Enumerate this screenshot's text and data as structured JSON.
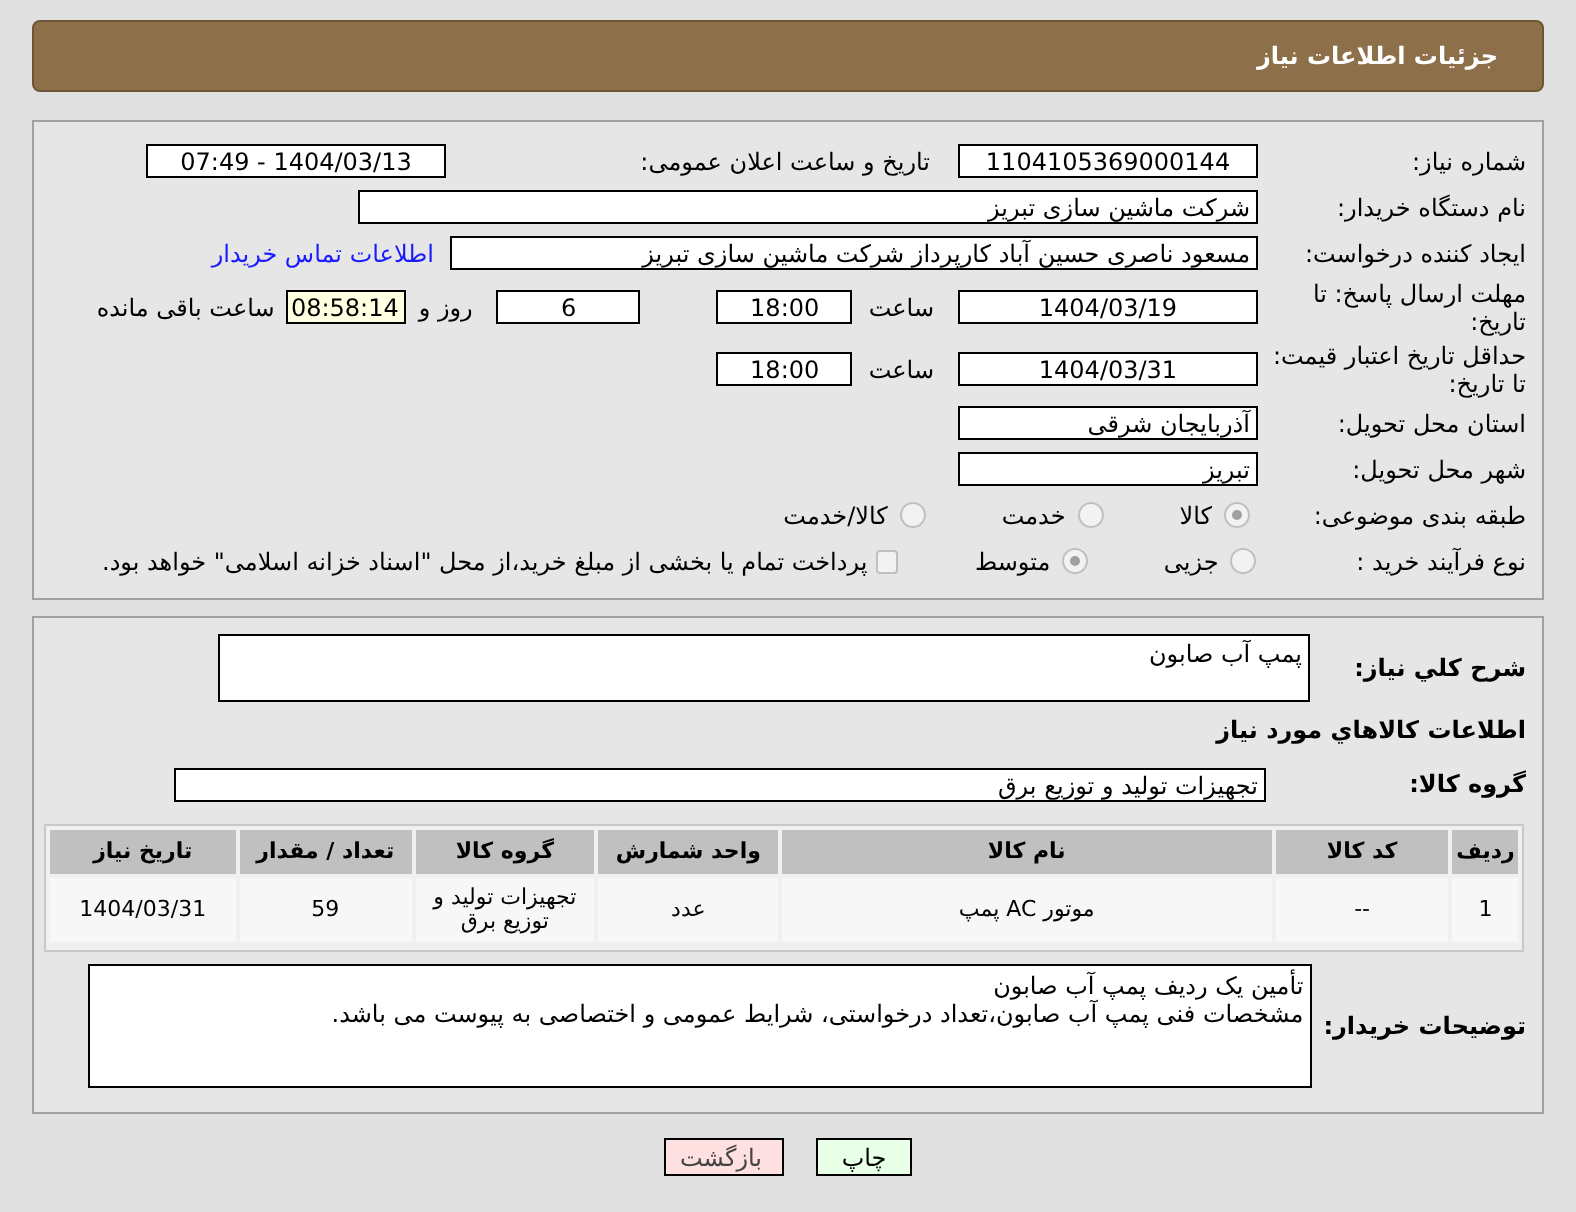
{
  "header": {
    "title": "جزئیات اطلاعات نیاز"
  },
  "need_number": {
    "label": "شماره نیاز:",
    "value": "1104105369000144"
  },
  "announce": {
    "label": "تاریخ و ساعت اعلان عمومی:",
    "value": "1404/03/13 - 07:49"
  },
  "buyer_org": {
    "label": "نام دستگاه خریدار:",
    "value": "شرکت ماشین سازی تبریز"
  },
  "requester": {
    "label": "ایجاد کننده درخواست:",
    "value": "مسعود ناصری حسین آباد کارپرداز شرکت ماشین سازی تبریز",
    "link": "اطلاعات تماس خریدار"
  },
  "reply_deadline": {
    "label": "مهلت ارسال پاسخ: تا تاریخ:",
    "date": "1404/03/19",
    "time_label": "ساعت",
    "time": "18:00",
    "days": "6",
    "days_label": "روز و",
    "remaining": "08:58:14",
    "remaining_label": "ساعت باقی مانده"
  },
  "validity": {
    "label": "حداقل تاریخ اعتبار قیمت: تا تاریخ:",
    "date": "1404/03/31",
    "time_label": "ساعت",
    "time": "18:00"
  },
  "province": {
    "label": "استان محل تحویل:",
    "value": "آذربایجان شرقی"
  },
  "city": {
    "label": "شهر محل تحویل:",
    "value": "تبریز"
  },
  "category": {
    "label": "طبقه بندی موضوعی:",
    "options": [
      {
        "label": "کالا",
        "selected": true
      },
      {
        "label": "خدمت",
        "selected": false
      },
      {
        "label": "کالا/خدمت",
        "selected": false
      }
    ]
  },
  "purchase_type": {
    "label": "نوع فرآیند خرید :",
    "options": [
      {
        "label": "جزیی",
        "selected": false
      },
      {
        "label": "متوسط",
        "selected": true
      }
    ],
    "payment": {
      "label": "پرداخت تمام یا بخشی از مبلغ خرید،از محل \"اسناد خزانه اسلامی\" خواهد بود.",
      "checked": false
    }
  },
  "description": {
    "label": "شرح کلي نياز:",
    "value": "پمپ آب صابون"
  },
  "goods_title": "اطلاعات کالاهاي مورد نياز",
  "goods_group": {
    "label": "گروه کالا:",
    "value": "تجهیزات تولید و توزیع برق"
  },
  "table": {
    "columns": [
      "ردیف",
      "کد کالا",
      "نام کالا",
      "واحد شمارش",
      "گروه کالا",
      "تعداد / مقدار",
      "تاریخ نیاز"
    ],
    "rows": [
      [
        "1",
        "--",
        "موتور AC پمپ",
        "عدد",
        "تجهیزات تولید و توزیع برق",
        "59",
        "1404/03/31"
      ]
    ]
  },
  "buyer_notes": {
    "label": "توضیحات خریدار:",
    "lines": [
      "تأمین یک ردیف پمپ آب صابون",
      "مشخصات فنی  پمپ آب صابون،تعداد درخواستی، شرایط عمومی و اختصاصی به پیوست می باشد."
    ]
  },
  "buttons": [
    {
      "label": "چاپ",
      "kind": "print"
    },
    {
      "label": "بازگشت",
      "kind": "back"
    }
  ]
}
